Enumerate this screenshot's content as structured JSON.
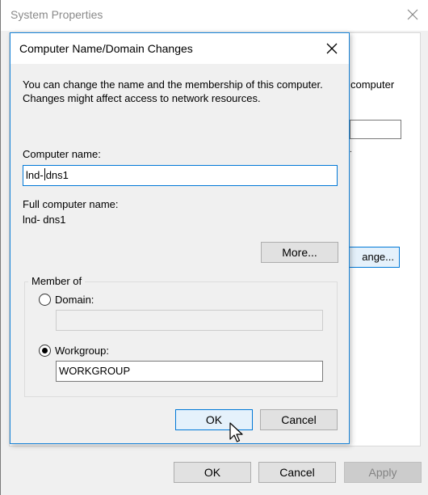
{
  "background_window": {
    "title": "System Properties",
    "peek_text": "computer",
    "peek_dot": ".",
    "peek_change_button": "ange...",
    "buttons": {
      "ok": "OK",
      "cancel": "Cancel",
      "apply": "Apply"
    }
  },
  "dialog": {
    "title": "Computer Name/Domain Changes",
    "description": "You can change the name and the membership of this computer. Changes might affect access to network resources.",
    "computer_name_label": "Computer name:",
    "computer_name_before_caret": "lnd-",
    "computer_name_after_caret": "dns1",
    "full_name_label": "Full computer name:",
    "full_name_value": "lnd- dns1",
    "more_button": "More...",
    "member_of": {
      "legend": "Member of",
      "domain_label": "Domain:",
      "domain_value": "",
      "workgroup_label": "Workgroup:",
      "workgroup_value": "WORKGROUP",
      "selected": "workgroup"
    },
    "ok_button": "OK",
    "cancel_button": "Cancel"
  },
  "colors": {
    "accent": "#0078d7",
    "dialog_border": "#1883d7",
    "window_bg": "#f0f0f0"
  },
  "icons": {
    "close": "close-icon",
    "pointer": "mouse-pointer-icon"
  }
}
